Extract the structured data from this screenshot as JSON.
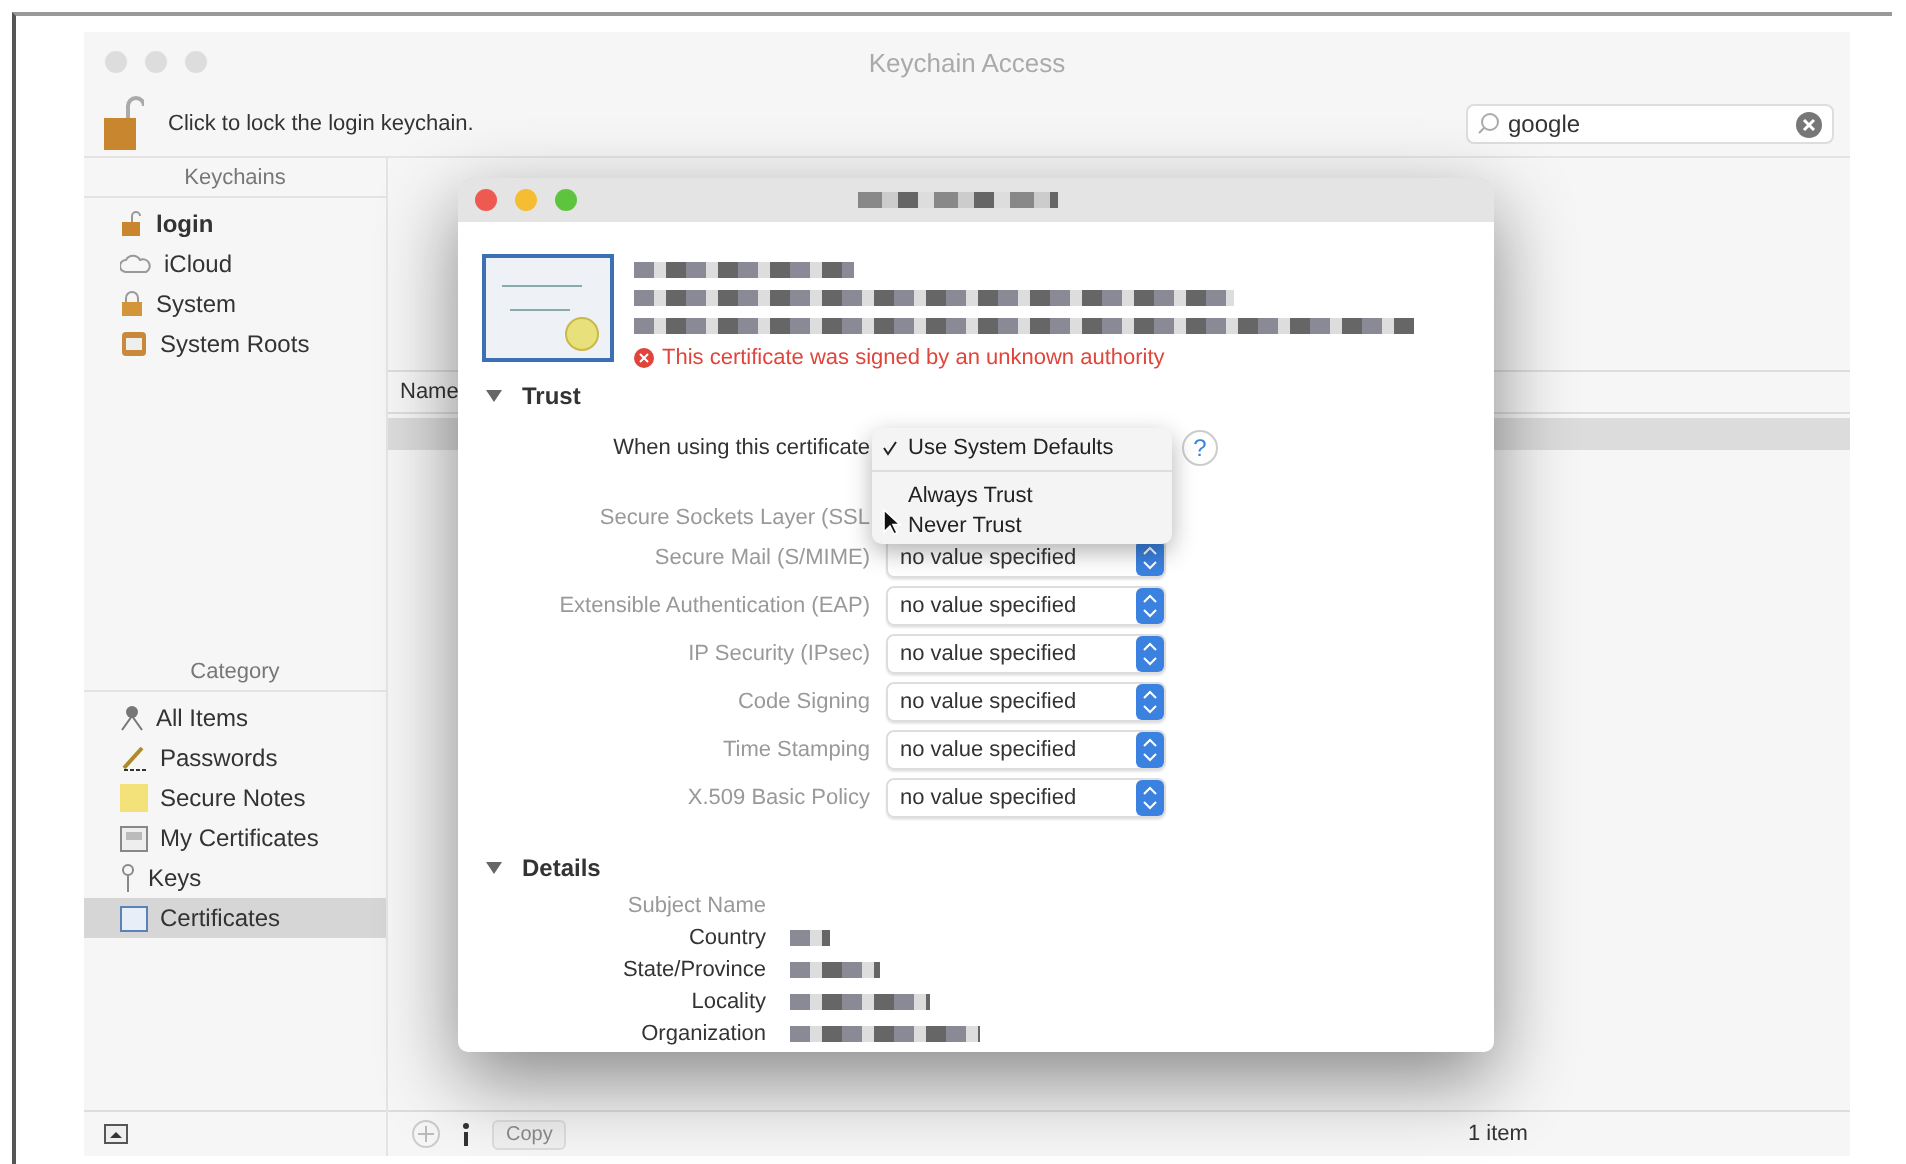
{
  "window": {
    "title": "Keychain Access"
  },
  "toolbar": {
    "lock_text": "Click to lock the login keychain.",
    "search": {
      "value": "google"
    }
  },
  "sidebar": {
    "keychains_header": "Keychains",
    "keychains": [
      {
        "label": "login",
        "kind": "login",
        "default": true
      },
      {
        "label": "iCloud",
        "kind": "cloud",
        "default": false
      },
      {
        "label": "System",
        "kind": "lock",
        "default": false
      },
      {
        "label": "System Roots",
        "kind": "roots",
        "default": false
      }
    ],
    "category_header": "Category",
    "categories": [
      {
        "label": "All Items",
        "kind": "all",
        "selected": false
      },
      {
        "label": "Passwords",
        "kind": "password",
        "selected": false
      },
      {
        "label": "Secure Notes",
        "kind": "note",
        "selected": false
      },
      {
        "label": "My Certificates",
        "kind": "mycert",
        "selected": false
      },
      {
        "label": "Keys",
        "kind": "key",
        "selected": false
      },
      {
        "label": "Certificates",
        "kind": "cert",
        "selected": true
      }
    ]
  },
  "list": {
    "columns": [
      "Name"
    ]
  },
  "status_bar": {
    "copy_button": {
      "label": "Copy",
      "disabled": true
    },
    "count": "1 item"
  },
  "dialog": {
    "error": "This certificate was signed by an unknown authority",
    "trust": {
      "title": "Trust",
      "expanded": true,
      "when_label": "When using this certificate",
      "menu": [
        {
          "label": "Use System Defaults",
          "checked": true
        },
        {
          "label": "Always Trust",
          "checked": false
        },
        {
          "label": "Never Trust",
          "checked": false
        }
      ],
      "help": "?",
      "ssl_label": "Secure Sockets Layer (SSL",
      "rows": [
        {
          "label": "Secure Mail (S/MIME)",
          "value": "no value specified"
        },
        {
          "label": "Extensible Authentication (EAP)",
          "value": "no value specified"
        },
        {
          "label": "IP Security (IPsec)",
          "value": "no value specified"
        },
        {
          "label": "Code Signing",
          "value": "no value specified"
        },
        {
          "label": "Time Stamping",
          "value": "no value specified"
        },
        {
          "label": "X.509 Basic Policy",
          "value": "no value specified"
        }
      ]
    },
    "details": {
      "title": "Details",
      "expanded": true,
      "subject_header": "Subject Name",
      "fields": [
        "Country",
        "State/Province",
        "Locality",
        "Organization"
      ]
    }
  }
}
